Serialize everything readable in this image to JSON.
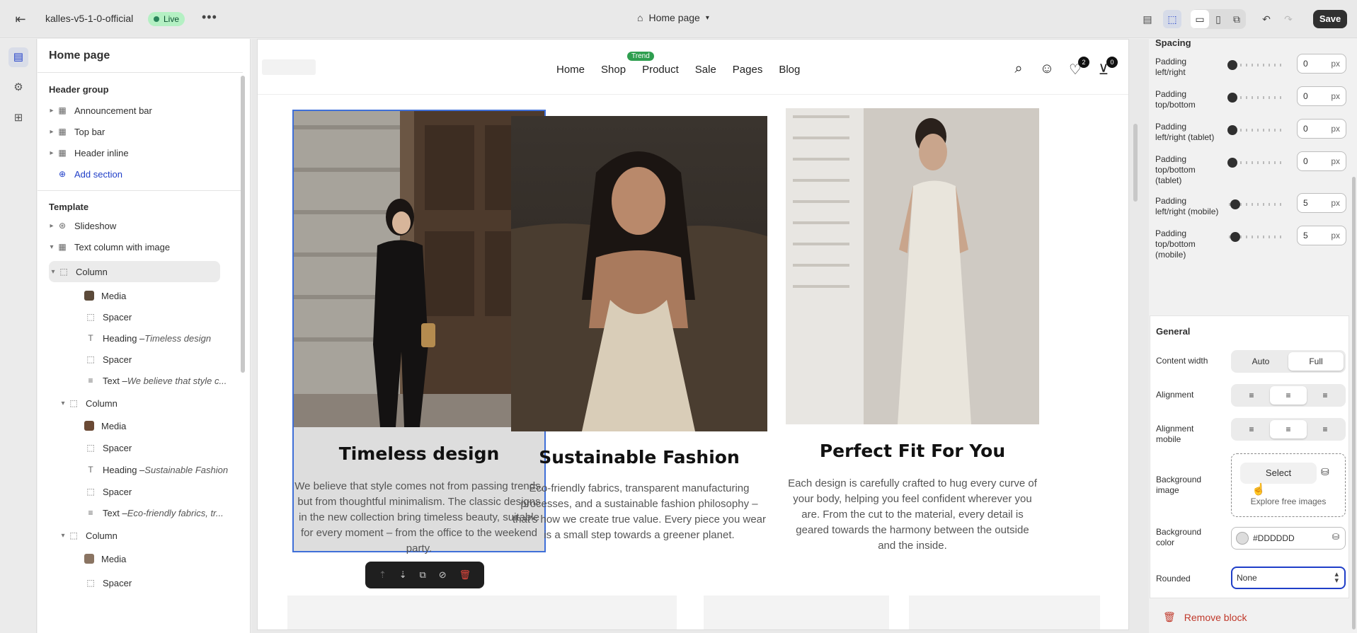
{
  "topbar": {
    "store_name": "kalles-v5-1-0-official",
    "status": "Live",
    "more": "•••",
    "page_label": "Home page",
    "save_label": "Save"
  },
  "sidebar": {
    "title": "Home page",
    "header_group": {
      "title": "Header group",
      "items": [
        "Announcement bar",
        "Top bar",
        "Header inline"
      ],
      "add_section": "Add section"
    },
    "template": {
      "title": "Template",
      "slideshow": "Slideshow",
      "text_column": "Text column with image",
      "column": "Column",
      "media": "Media",
      "spacer": "Spacer",
      "heading_prefix": "Heading – ",
      "text_prefix": "Text – ",
      "col1_heading": "Timeless design",
      "col1_text": "We believe that style c...",
      "col2_heading": "Sustainable Fashion",
      "col2_text": "Eco-friendly fabrics, tr..."
    }
  },
  "store": {
    "nav": [
      "Home",
      "Shop",
      "Product",
      "Sale",
      "Pages",
      "Blog"
    ],
    "trend_badge": "Trend",
    "wishlist_count": "2",
    "cart_count": "0",
    "columns": [
      {
        "heading": "Timeless design",
        "text": "We believe that style comes not from passing trends, but from thoughtful minimalism. The classic designs in the new collection bring timeless beauty, suitable for every moment – from the office to the weekend party."
      },
      {
        "heading": "Sustainable Fashion",
        "text": "Eco-friendly fabrics, transparent manufacturing processes, and a sustainable fashion philosophy – that's how we create true value. Every piece you wear is a small step towards a greener planet."
      },
      {
        "heading": "Perfect Fit For You",
        "text": "Each design is carefully crafted to hug every curve of your body, helping you feel confident wherever you are. From the cut to the material, every detail is geared towards the harmony between the outside and the inside."
      }
    ]
  },
  "settings": {
    "spacing_title": "Spacing",
    "unit": "px",
    "paddings": [
      {
        "label": "Padding left/right",
        "value": "0",
        "fraction": 0
      },
      {
        "label": "Padding top/bottom",
        "value": "0",
        "fraction": 0
      },
      {
        "label": "Padding left/right (tablet)",
        "value": "0",
        "fraction": 0
      },
      {
        "label": "Padding top/bottom (tablet)",
        "value": "0",
        "fraction": 0
      },
      {
        "label": "Padding left/right (mobile)",
        "value": "5",
        "fraction": 0.05
      },
      {
        "label": "Padding top/bottom (mobile)",
        "value": "5",
        "fraction": 0.05
      }
    ],
    "general": {
      "title": "General",
      "content_width_label": "Content width",
      "content_width_options": [
        "Auto",
        "Full"
      ],
      "content_width_selected": "Full",
      "alignment_label": "Alignment",
      "alignment_mobile_label": "Alignment mobile",
      "alignment_selected": "center",
      "background_image_label": "Background image",
      "select_label": "Select",
      "explore_label": "Explore free images",
      "background_color_label": "Background color",
      "background_color": "#DDDDDD",
      "rounded_label": "Rounded",
      "rounded_value": "None"
    },
    "remove_block": "Remove block"
  },
  "colors": {
    "accent": "#1f3ec8",
    "live_bg": "#b4f0c3",
    "selection_border": "#3f6fd8",
    "danger": "#c0392b"
  }
}
